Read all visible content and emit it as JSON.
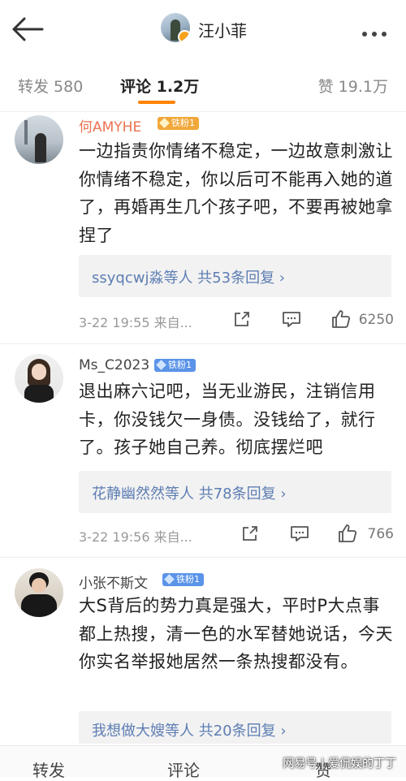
{
  "header": {
    "title": "汪小菲"
  },
  "tabs": [
    {
      "label": "转发 580"
    },
    {
      "label": "评论 1.2万"
    },
    {
      "label": "赞 19.1万"
    }
  ],
  "comments": [
    {
      "username": "何AMYHE",
      "badge": "铁粉1",
      "text": "一边指责你情绪不稳定，一边故意刺激让你情绪不稳定，你以后可不能再入她的道了，再婚再生几个孩子吧，不要再被她拿捏了",
      "reply_summary": "ssyqcwj淼等人 共53条回复 ›",
      "time": "3-22 19:55 来自...",
      "likes": "6250"
    },
    {
      "username": "Ms_C2023",
      "badge": "铁粉1",
      "text": "退出麻六记吧，当无业游民，注销信用卡，你没钱欠一身债。没钱给了，就行了。孩子她自己养。彻底摆烂吧",
      "reply_summary": "花静幽然然等人 共78条回复 ›",
      "time": "3-22 19:56 来自...",
      "likes": "766"
    },
    {
      "username": "小张不斯文",
      "badge": "铁粉1",
      "text": "大S背后的势力真是强大，平时P大点事都上热搜，清一色的水军替她说话，今天你实名举报她居然一条热搜都没有。",
      "reply_summary": "我想做大嫂等人 共20条回复 ›"
    }
  ],
  "bottom_bar": {
    "repost": "转发",
    "comment": "评论",
    "like": "赞"
  },
  "watermark": "网易号 | 爱侃娱的丁丁",
  "colors": {
    "accent": "#ff8200",
    "username_highlight": "#eb7350",
    "reply_link": "#5d7db3",
    "fan_badge": "#5a93e8"
  }
}
